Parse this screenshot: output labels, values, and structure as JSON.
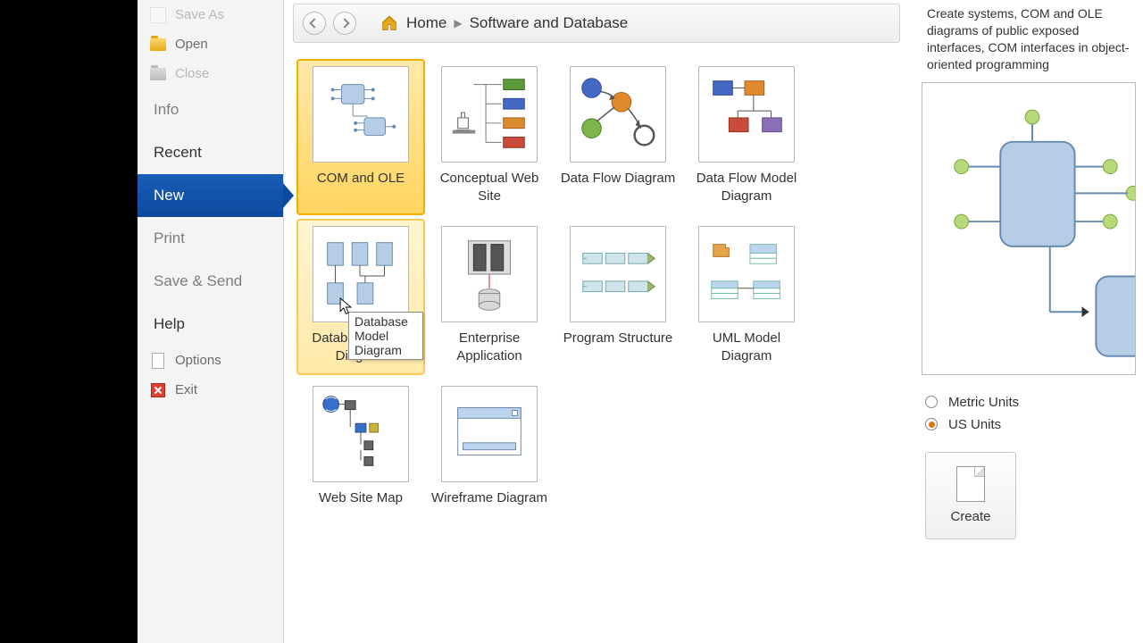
{
  "sidebar": {
    "save_as": "Save As",
    "open": "Open",
    "close": "Close",
    "info": "Info",
    "recent": "Recent",
    "new": "New",
    "print": "Print",
    "save_send": "Save & Send",
    "help": "Help",
    "options": "Options",
    "exit": "Exit"
  },
  "breadcrumb": {
    "home": "Home",
    "category": "Software and Database"
  },
  "templates": [
    {
      "label": "COM and OLE"
    },
    {
      "label": "Conceptual Web Site"
    },
    {
      "label": "Data Flow Diagram"
    },
    {
      "label": "Data Flow Model Diagram"
    },
    {
      "label": "Database Model Diagram"
    },
    {
      "label": "Enterprise Application"
    },
    {
      "label": "Program Structure"
    },
    {
      "label": "UML Model Diagram"
    },
    {
      "label": "Web Site Map"
    },
    {
      "label": "Wireframe Diagram"
    }
  ],
  "tooltip": "Database Model Diagram",
  "preview": {
    "description": "Create systems, COM and OLE diagrams of public exposed interfaces, COM interfaces in object-oriented programming",
    "units": {
      "metric": "Metric Units",
      "us": "US Units",
      "selected": "us"
    },
    "create_label": "Create"
  }
}
